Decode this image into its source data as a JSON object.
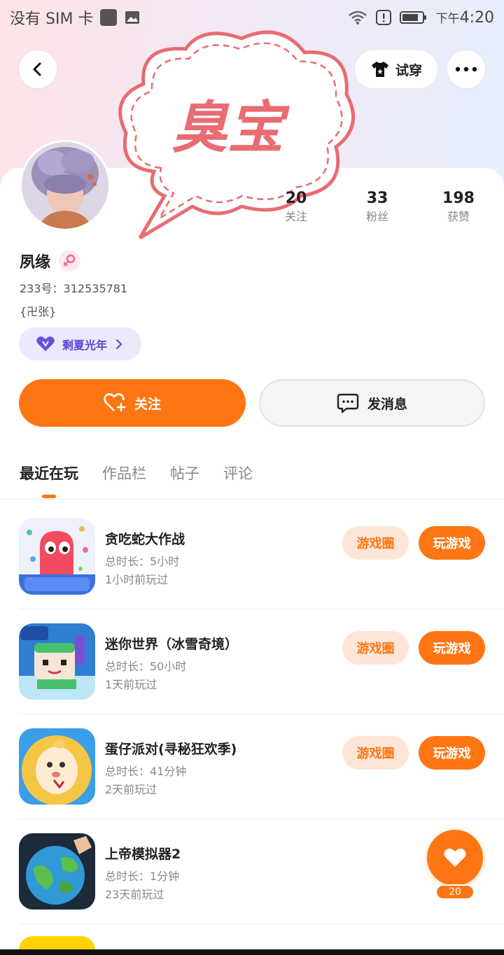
{
  "status_bar": {
    "carrier": "没有 SIM 卡",
    "time_prefix": "下午",
    "time": "4:20"
  },
  "nav": {
    "try_on_label": "试穿"
  },
  "sticker": {
    "text": "臭宝",
    "color": "#e86c72"
  },
  "profile": {
    "name": "夙缘",
    "id_label": "233号：312535781",
    "bio": "{卍张}",
    "group_label": "剩夏光年",
    "stats": [
      {
        "num": "20",
        "label": "关注"
      },
      {
        "num": "33",
        "label": "粉丝"
      },
      {
        "num": "198",
        "label": "获赞"
      }
    ]
  },
  "actions": {
    "follow_label": "关注",
    "message_label": "发消息"
  },
  "tabs": [
    "最近在玩",
    "作品栏",
    "帖子",
    "评论"
  ],
  "games": [
    {
      "title": "贪吃蛇大作战",
      "duration": "总时长：5小时",
      "last_played": "1小时前玩过",
      "circle_label": "游戏圈",
      "play_label": "玩游戏",
      "icon": "snake-game-icon"
    },
    {
      "title": "迷你世界（冰雪奇境）",
      "duration": "总时长：50小时",
      "last_played": "1天前玩过",
      "circle_label": "游戏圈",
      "play_label": "玩游戏",
      "icon": "mini-world-icon"
    },
    {
      "title": "蛋仔派对(寻秘狂欢季)",
      "duration": "总时长：41分钟",
      "last_played": "2天前玩过",
      "circle_label": "游戏圈",
      "play_label": "玩游戏",
      "icon": "eggy-party-icon"
    },
    {
      "title": "上帝模拟器2",
      "duration": "总时长：1分钟",
      "last_played": "23天前玩过",
      "circle_label": "",
      "play_label": "",
      "icon": "god-simulator-icon"
    }
  ],
  "like_fab": {
    "count": "20"
  },
  "colors": {
    "accent": "#fe7613",
    "group_chip": "#5b45d6"
  }
}
